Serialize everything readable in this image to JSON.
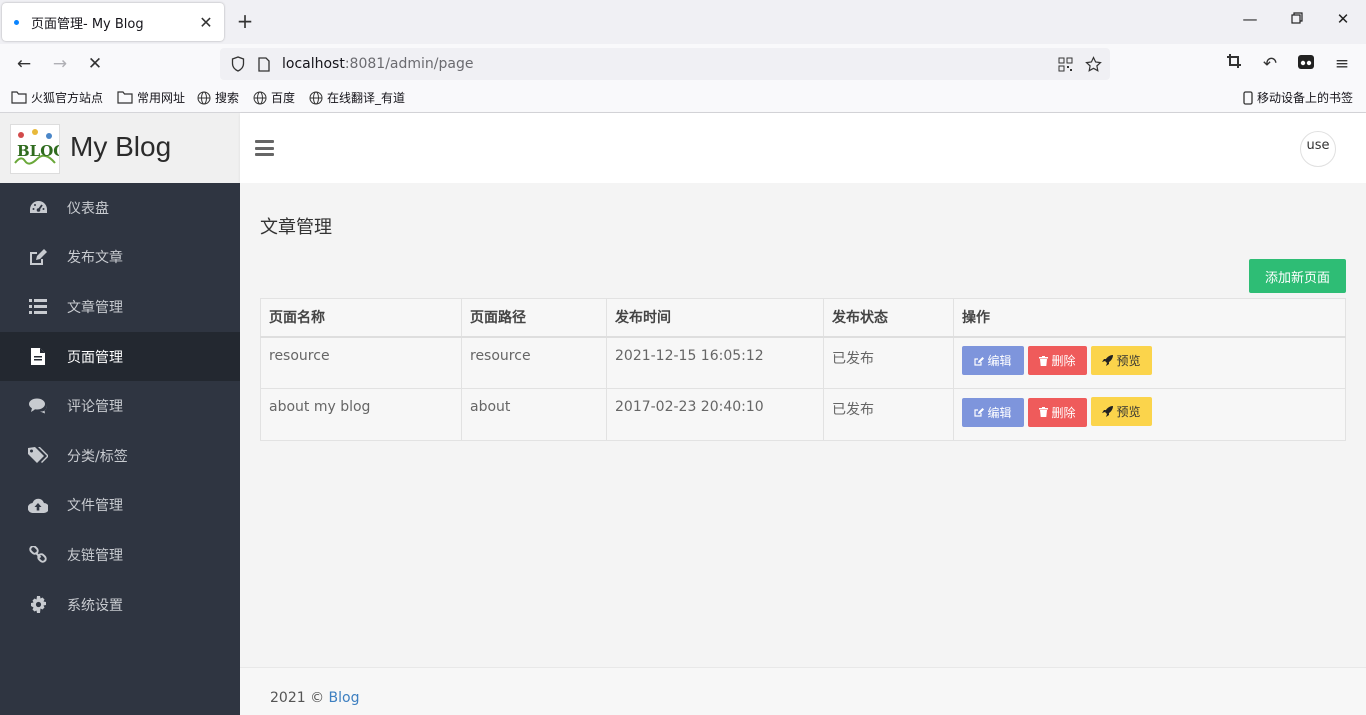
{
  "browser": {
    "tab_title": "页面管理- My Blog",
    "url_host": "localhost",
    "url_rest": ":8081/admin/page",
    "bookmarks": [
      "火狐官方站点",
      "常用网址",
      "搜索",
      "百度",
      "在线翻译_有道"
    ],
    "mobile_bookmarks": "移动设备上的书签"
  },
  "app": {
    "logo_text": "My Blog",
    "logo_image_text": "BLOG",
    "user_label": "use",
    "menu": [
      {
        "label": "仪表盘",
        "icon": "dashboard-icon"
      },
      {
        "label": "发布文章",
        "icon": "edit-icon"
      },
      {
        "label": "文章管理",
        "icon": "list-icon"
      },
      {
        "label": "页面管理",
        "icon": "file-icon",
        "active": true
      },
      {
        "label": "评论管理",
        "icon": "comments-icon"
      },
      {
        "label": "分类/标签",
        "icon": "tags-icon"
      },
      {
        "label": "文件管理",
        "icon": "cloud-upload-icon"
      },
      {
        "label": "友链管理",
        "icon": "link-icon"
      },
      {
        "label": "系统设置",
        "icon": "gear-icon"
      }
    ]
  },
  "main": {
    "title": "文章管理",
    "add_button": "添加新页面",
    "columns": [
      "页面名称",
      "页面路径",
      "发布时间",
      "发布状态",
      "操作"
    ],
    "rows": [
      {
        "name": "resource",
        "path": "resource",
        "time": "2021-12-15 16:05:12",
        "status": "已发布"
      },
      {
        "name": "about my blog",
        "path": "about",
        "time": "2017-02-23 20:40:10",
        "status": "已发布"
      }
    ],
    "actions": {
      "edit": "编辑",
      "delete": "删除",
      "preview": "预览"
    }
  },
  "footer": {
    "text": "2021 © ",
    "link": "Blog"
  },
  "colors": {
    "sidebar_bg": "#2f3541",
    "add_button": "#2ebd75",
    "edit_button": "#7e95dc",
    "delete_button": "#ef5b5b",
    "preview_button": "#fbd44b"
  }
}
